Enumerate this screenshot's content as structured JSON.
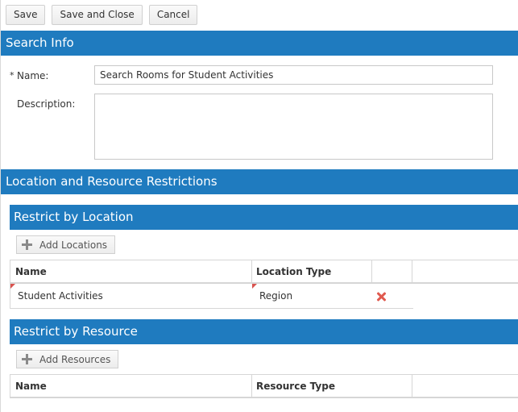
{
  "toolbar": {
    "save": "Save",
    "save_close": "Save and Close",
    "cancel": "Cancel"
  },
  "search_info": {
    "header": "Search Info",
    "name_required_mark": "*",
    "name_label": "Name:",
    "name_value": "Search Rooms for Student Activities",
    "description_label": "Description:",
    "description_value": ""
  },
  "restrictions": {
    "header": "Location and Resource Restrictions",
    "location": {
      "header": "Restrict by Location",
      "add_button": "Add Locations",
      "columns": [
        "Name",
        "Location Type"
      ],
      "rows": [
        {
          "name": "Student Activities",
          "type": "Region"
        }
      ]
    },
    "resource": {
      "header": "Restrict by Resource",
      "add_button": "Add Resources",
      "columns": [
        "Name",
        "Resource Type"
      ],
      "rows": []
    }
  },
  "colors": {
    "header_blue": "#1f7bbf",
    "delete_red": "#e05a4f",
    "dirty_flag": "#d9534f"
  }
}
